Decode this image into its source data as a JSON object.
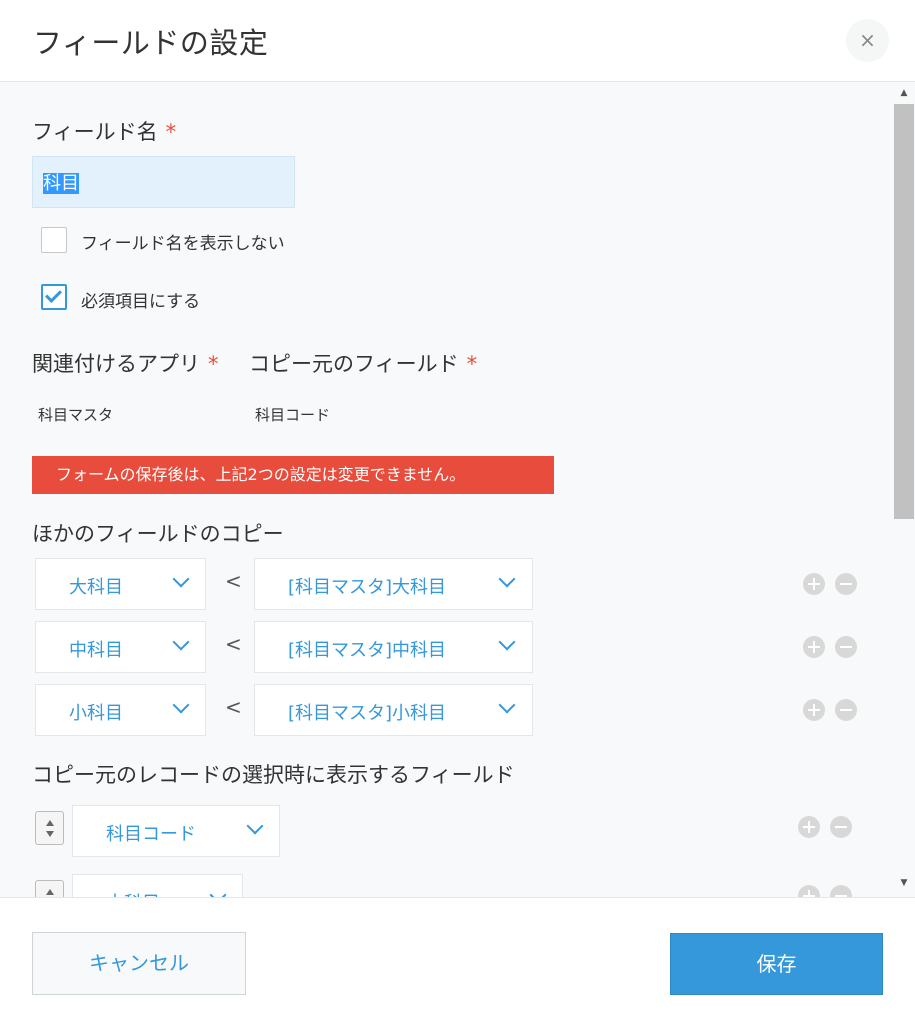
{
  "header": {
    "title": "フィールドの設定",
    "close_label": "×"
  },
  "field_name": {
    "label": "フィールド名",
    "required_mark": "*",
    "value": "科目",
    "hide_name_label": "フィールド名を表示しない",
    "hide_name_checked": false,
    "required_label": "必須項目にする",
    "required_checked": true
  },
  "lookup": {
    "app_label": "関連付けるアプリ",
    "app_required_mark": "*",
    "app_value": "科目マスタ",
    "source_field_label": "コピー元のフィールド",
    "source_field_required_mark": "*",
    "source_field_value": "科目コード",
    "warning": "フォームの保存後は、上記2つの設定は変更できません。"
  },
  "copy_fields": {
    "label": "ほかのフィールドのコピー",
    "separator": "<",
    "rows": [
      {
        "target": "大科目",
        "source": "[科目マスタ]大科目"
      },
      {
        "target": "中科目",
        "source": "[科目マスタ]中科目"
      },
      {
        "target": "小科目",
        "source": "[科目マスタ]小科目"
      }
    ]
  },
  "display_fields": {
    "label": "コピー元のレコードの選択時に表示するフィールド",
    "rows": [
      {
        "value": "科目コード"
      },
      {
        "value": "大科目"
      }
    ]
  },
  "footer": {
    "cancel_label": "キャンセル",
    "save_label": "保存"
  },
  "colors": {
    "accent": "#3498db",
    "error": "#e74c3c",
    "background": "#f7f9fa"
  }
}
